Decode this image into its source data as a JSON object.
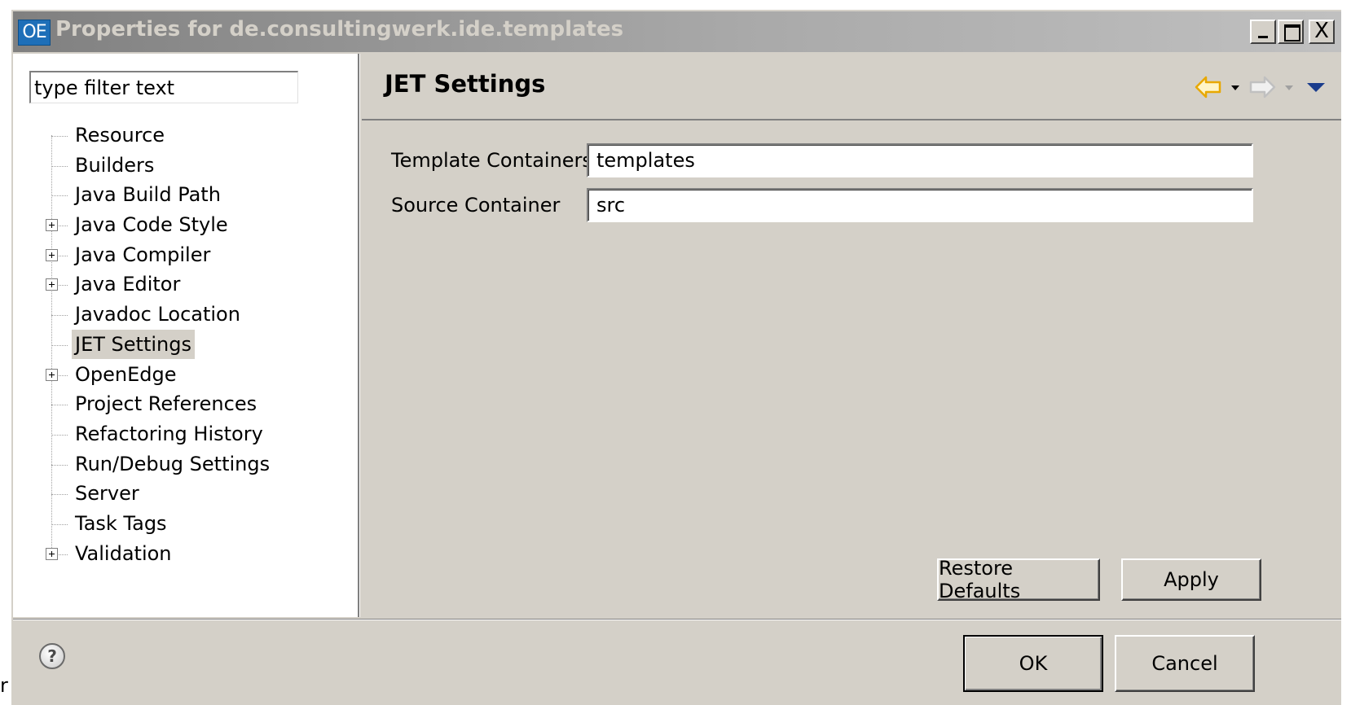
{
  "window": {
    "app_icon_text": "OE",
    "title": "Properties for de.consultingwerk.ide.templates",
    "controls": {
      "minimize": "_",
      "maximize": "□",
      "close": "X"
    }
  },
  "stray_text": "r",
  "left_pane": {
    "filter_placeholder": "type filter text",
    "filter_value": "type filter text",
    "tree_items": [
      {
        "label": "Resource",
        "expandable": false,
        "selected": false
      },
      {
        "label": "Builders",
        "expandable": false,
        "selected": false
      },
      {
        "label": "Java Build Path",
        "expandable": false,
        "selected": false
      },
      {
        "label": "Java Code Style",
        "expandable": true,
        "selected": false
      },
      {
        "label": "Java Compiler",
        "expandable": true,
        "selected": false
      },
      {
        "label": "Java Editor",
        "expandable": true,
        "selected": false
      },
      {
        "label": "Javadoc Location",
        "expandable": false,
        "selected": false
      },
      {
        "label": "JET Settings",
        "expandable": false,
        "selected": true
      },
      {
        "label": "OpenEdge",
        "expandable": true,
        "selected": false
      },
      {
        "label": "Project References",
        "expandable": false,
        "selected": false
      },
      {
        "label": "Refactoring History",
        "expandable": false,
        "selected": false
      },
      {
        "label": "Run/Debug Settings",
        "expandable": false,
        "selected": false
      },
      {
        "label": "Server",
        "expandable": false,
        "selected": false
      },
      {
        "label": "Task Tags",
        "expandable": false,
        "selected": false
      },
      {
        "label": "Validation",
        "expandable": true,
        "selected": false
      }
    ]
  },
  "page": {
    "title": "JET Settings",
    "fields": {
      "template_containers": {
        "label": "Template Containers",
        "value": "templates"
      },
      "source_container": {
        "label": "Source Container",
        "value": "src"
      }
    },
    "restore_defaults_label": "Restore Defaults",
    "apply_label": "Apply"
  },
  "footer": {
    "help_glyph": "?",
    "ok_label": "OK",
    "cancel_label": "Cancel"
  },
  "colors": {
    "dialog_bg": "#d4d0c8",
    "titlebar_text": "#d4d0c8",
    "nav_back_arrow": "#e8a800",
    "nav_forward_arrow": "#c0c0c0",
    "menu_triangle": "#1a3c8c"
  }
}
